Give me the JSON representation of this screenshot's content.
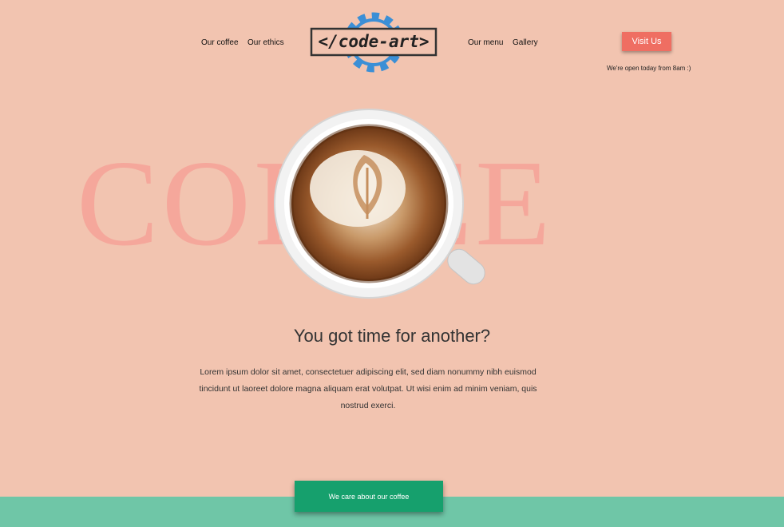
{
  "nav": {
    "left": [
      "Our coffee",
      "Our ethics"
    ],
    "right": [
      "Our menu",
      "Gallery"
    ]
  },
  "logo": {
    "text": "</code-art>",
    "icon": "gear-icon"
  },
  "header": {
    "visit_label": "Visit Us",
    "open_note": "We're open today from 8am :)"
  },
  "hero": {
    "background_word": "COFFEE",
    "heading": "You got time for another?",
    "paragraph": "Lorem ipsum dolor sit amet, consectetuer adipiscing elit, sed diam nonummy nibh euismod tincidunt ut laoreet dolore magna aliquam erat volutpat. Ut wisi enim ad minim veniam, quis nostrud exerci."
  },
  "footer": {
    "care_label": "We care about our coffee"
  },
  "colors": {
    "background": "#f2c4b0",
    "accent": "#ef6e62",
    "green": "#16a06d",
    "band": "#6fc6a7"
  }
}
